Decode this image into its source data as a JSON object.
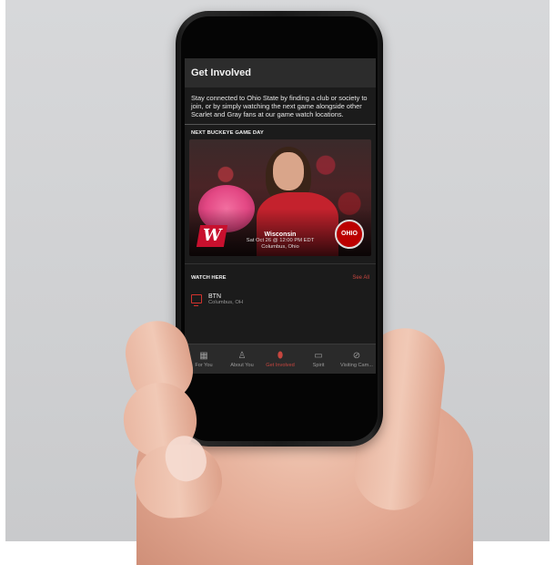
{
  "app": {
    "title": "Get Involved",
    "intro": "Stay connected to Ohio State by finding a club or society to join, or by simply watching the next game alongside other Scarlet and Gray fans at our game watch locations."
  },
  "next_game": {
    "section_label": "NEXT BUCKEYE GAME DAY",
    "opponent": "Wisconsin",
    "datetime": "Sat Oct 26 @ 12:00 PM EDT",
    "location": "Columbus, Ohio",
    "opponent_logo_text": "W",
    "home_logo_text": "OHIO STATE"
  },
  "watch": {
    "section_label": "WATCH HERE",
    "see_all": "See All",
    "locations": [
      {
        "name": "BTN",
        "city": "Columbus, OH"
      }
    ]
  },
  "tabs": [
    {
      "label": "For You",
      "icon": "grid-icon"
    },
    {
      "label": "About You",
      "icon": "person-icon"
    },
    {
      "label": "Get Involved",
      "icon": "football-icon",
      "active": true
    },
    {
      "label": "Spirit",
      "icon": "chat-icon"
    },
    {
      "label": "Visiting Cam...",
      "icon": "compass-icon"
    }
  ],
  "colors": {
    "accent": "#c6463f",
    "app_bg": "#1b1b1b",
    "scarlet": "#bb0000"
  }
}
